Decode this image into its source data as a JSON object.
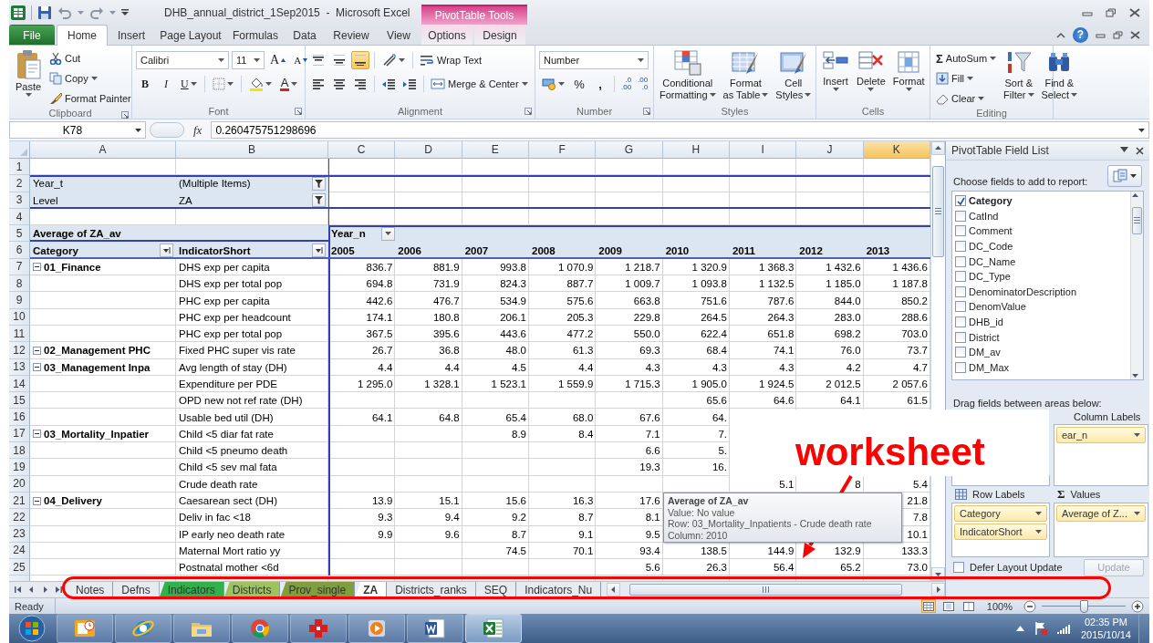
{
  "title_bar": {
    "title": "DHB_annual_district_1Sep2015  -  Microsoft Excel",
    "context_group": "PivotTable Tools"
  },
  "ribbon_tabs": [
    {
      "label": "File",
      "kind": "file",
      "selected": false
    },
    {
      "label": "Home",
      "kind": "tab",
      "selected": true
    },
    {
      "label": "Insert",
      "kind": "tab",
      "selected": false
    },
    {
      "label": "Page Layout",
      "kind": "tab",
      "selected": false
    },
    {
      "label": "Formulas",
      "kind": "tab",
      "selected": false
    },
    {
      "label": "Data",
      "kind": "tab",
      "selected": false
    },
    {
      "label": "Review",
      "kind": "tab",
      "selected": false
    },
    {
      "label": "View",
      "kind": "tab",
      "selected": false
    },
    {
      "label": "Options",
      "kind": "context",
      "selected": false
    },
    {
      "label": "Design",
      "kind": "context",
      "selected": false
    }
  ],
  "help": "?",
  "clipboard": {
    "label": "Clipboard",
    "paste": "Paste",
    "cut": "Cut",
    "copy": "Copy",
    "format_painter": "Format Painter"
  },
  "font": {
    "label": "Font",
    "name": "Calibri",
    "size": "11",
    "grow": "A",
    "shrink": "A",
    "bold": "B",
    "italic": "I",
    "underline": "U",
    "font_color": "A"
  },
  "alignment": {
    "label": "Alignment",
    "vertical": [
      {
        "selected": false
      },
      {
        "selected": false
      },
      {
        "selected": true
      }
    ],
    "wrap_text": "Wrap Text",
    "merge_center": "Merge & Center"
  },
  "number": {
    "label": "Number",
    "format": "Number",
    "percent": "%",
    "comma": ",",
    "increase_decimal": [
      ".0",
      ".00"
    ],
    "decrease_decimal": [
      ".00",
      ".0"
    ]
  },
  "styles": {
    "label": "Styles",
    "buttons": [
      [
        "Conditional",
        "Formatting"
      ],
      [
        "Format",
        "as Table"
      ],
      [
        "Cell",
        "Styles"
      ]
    ]
  },
  "cells": {
    "label": "Cells",
    "buttons": [
      "Insert",
      "Delete",
      "Format"
    ]
  },
  "editing": {
    "label": "Editing",
    "sigma": "Σ",
    "autosum": "AutoSum",
    "fill": "Fill",
    "clear": "Clear",
    "sort_filter": [
      "Sort &",
      "Filter"
    ],
    "find_select": [
      "Find &",
      "Select"
    ]
  },
  "formula_bar": {
    "name_box": "K78",
    "fx": "fx",
    "value": "0.260475751298696"
  },
  "sheet": {
    "columns": [
      {
        "letter": "A",
        "selected": false
      },
      {
        "letter": "B",
        "selected": false
      },
      {
        "letter": "C",
        "selected": false
      },
      {
        "letter": "D",
        "selected": false
      },
      {
        "letter": "E",
        "selected": false
      },
      {
        "letter": "F",
        "selected": false
      },
      {
        "letter": "G",
        "selected": false
      },
      {
        "letter": "H",
        "selected": false
      },
      {
        "letter": "I",
        "selected": false
      },
      {
        "letter": "J",
        "selected": false
      },
      {
        "letter": "K",
        "selected": true
      }
    ],
    "rows": [
      {
        "number": "1",
        "kind": "blank"
      },
      {
        "number": "2",
        "kind": "filter",
        "cells": {
          "A": "Year_t",
          "B": "(Multiple Items)"
        }
      },
      {
        "number": "3",
        "kind": "filter",
        "cells": {
          "A": "Level",
          "B": "ZA"
        }
      },
      {
        "number": "4",
        "kind": "blank"
      },
      {
        "number": "5",
        "kind": "value_header",
        "cells": {
          "A": "Average of ZA_av",
          "C": "Year_n"
        }
      },
      {
        "number": "6",
        "kind": "field_header",
        "cells": {
          "A": "Category",
          "B": "IndicatorShort",
          "C": "2005",
          "D": "2006",
          "E": "2007",
          "F": "2008",
          "G": "2009",
          "H": "2010",
          "I": "2011",
          "J": "2012",
          "K": "2013"
        }
      },
      {
        "number": "7",
        "kind": "data",
        "category": {
          "text": "01_Finance",
          "expanded": true
        },
        "cells": {
          "B": "DHS exp per capita",
          "C": "836.7",
          "D": "881.9",
          "E": "993.8",
          "F": "1 070.9",
          "G": "1 218.7",
          "H": "1 320.9",
          "I": "1 368.3",
          "J": "1 432.6",
          "K": "1 436.6"
        }
      },
      {
        "number": "8",
        "kind": "data",
        "cells": {
          "B": "DHS exp per total pop",
          "C": "694.8",
          "D": "731.9",
          "E": "824.3",
          "F": "887.7",
          "G": "1 009.7",
          "H": "1 093.8",
          "I": "1 132.5",
          "J": "1 185.0",
          "K": "1 187.8"
        }
      },
      {
        "number": "9",
        "kind": "data",
        "cells": {
          "B": "PHC exp per capita",
          "C": "442.6",
          "D": "476.7",
          "E": "534.9",
          "F": "575.6",
          "G": "663.8",
          "H": "751.6",
          "I": "787.6",
          "J": "844.0",
          "K": "850.2"
        }
      },
      {
        "number": "10",
        "kind": "data",
        "cells": {
          "B": "PHC exp per headcount",
          "C": "174.1",
          "D": "180.8",
          "E": "206.1",
          "F": "205.3",
          "G": "229.8",
          "H": "264.5",
          "I": "264.3",
          "J": "283.0",
          "K": "288.6"
        }
      },
      {
        "number": "11",
        "kind": "data",
        "cells": {
          "B": "PHC exp per total pop",
          "C": "367.5",
          "D": "395.6",
          "E": "443.6",
          "F": "477.2",
          "G": "550.0",
          "H": "622.4",
          "I": "651.8",
          "J": "698.2",
          "K": "703.0"
        }
      },
      {
        "number": "12",
        "kind": "data",
        "category": {
          "text": "02_Management PHC",
          "expanded": true
        },
        "cells": {
          "B": "Fixed PHC super vis rate",
          "C": "26.7",
          "D": "36.8",
          "E": "48.0",
          "F": "61.3",
          "G": "69.3",
          "H": "68.4",
          "I": "74.1",
          "J": "76.0",
          "K": "73.7"
        }
      },
      {
        "number": "13",
        "kind": "data",
        "category": {
          "text": "03_Management Inpa",
          "expanded": true
        },
        "cells": {
          "B": "Avg length of stay (DH)",
          "C": "4.4",
          "D": "4.4",
          "E": "4.5",
          "F": "4.4",
          "G": "4.3",
          "H": "4.3",
          "I": "4.3",
          "J": "4.2",
          "K": "4.7"
        }
      },
      {
        "number": "14",
        "kind": "data",
        "cells": {
          "B": "Expenditure per PDE",
          "C": "1 295.0",
          "D": "1 328.1",
          "E": "1 523.1",
          "F": "1 559.9",
          "G": "1 715.3",
          "H": "1 905.0",
          "I": "1 924.5",
          "J": "2 012.5",
          "K": "2 057.6"
        }
      },
      {
        "number": "15",
        "kind": "data",
        "cells": {
          "B": "OPD new not ref rate (DH)",
          "H": "65.6",
          "I": "64.6",
          "J": "64.1",
          "K": "61.5"
        }
      },
      {
        "number": "16",
        "kind": "data",
        "cells": {
          "B": "Usable bed util (DH)",
          "C": "64.1",
          "D": "64.8",
          "E": "65.4",
          "F": "68.0",
          "G": "67.6",
          "H": "64."
        }
      },
      {
        "number": "17",
        "kind": "data",
        "category": {
          "text": "03_Mortality_Inpatier",
          "expanded": true
        },
        "cells": {
          "B": "Child <5 diar fat rate",
          "E": "8.9",
          "F": "8.4",
          "G": "7.1",
          "H": "7."
        }
      },
      {
        "number": "18",
        "kind": "data",
        "cells": {
          "B": "Child <5 pneumo death",
          "G": "6.6",
          "H": "5."
        }
      },
      {
        "number": "19",
        "kind": "data",
        "cells": {
          "B": "Child <5 sev mal fata",
          "G": "19.3",
          "H": "16."
        }
      },
      {
        "number": "20",
        "kind": "data",
        "cells": {
          "B": "Crude death rate",
          "I": "5.1",
          "J": "8",
          "K": "5.4"
        }
      },
      {
        "number": "21",
        "kind": "data",
        "category": {
          "text": "04_Delivery",
          "expanded": true
        },
        "cells": {
          "B": "Caesarean sect (DH)",
          "C": "13.9",
          "D": "15.1",
          "E": "15.6",
          "F": "16.3",
          "G": "17.6",
          "K": "21.8"
        }
      },
      {
        "number": "22",
        "kind": "data",
        "cells": {
          "B": "Deliv in fac <18",
          "C": "9.3",
          "D": "9.4",
          "E": "9.2",
          "F": "8.7",
          "G": "8.1",
          "K": "7.8"
        }
      },
      {
        "number": "23",
        "kind": "data",
        "cells": {
          "B": "IP early neo death rate",
          "C": "9.9",
          "D": "9.6",
          "E": "8.7",
          "F": "9.1",
          "G": "9.5",
          "K": "10.1"
        }
      },
      {
        "number": "24",
        "kind": "data",
        "cells": {
          "B": "Maternal Mort ratio yy",
          "E": "74.5",
          "F": "70.1",
          "G": "93.4",
          "H": "138.5",
          "I": "144.9",
          "J": "132.9",
          "K": "133.3"
        }
      },
      {
        "number": "25",
        "kind": "data",
        "cells": {
          "B": "Postnatal mother <6d",
          "G": "5.6",
          "H": "26.3",
          "I": "56.4",
          "J": "65.2",
          "K": "73.0"
        }
      }
    ]
  },
  "tooltip": {
    "title": "Average of ZA_av",
    "lines": [
      "Value: No value",
      "Row: 03_Mortality_Inpatients - Crude death rate",
      "Column: 2010"
    ]
  },
  "annotation": {
    "label": "worksheet"
  },
  "sheet_tabs": [
    {
      "label": "Notes",
      "selected": false
    },
    {
      "label": "Defns",
      "selected": false
    },
    {
      "label": "Indicators",
      "selected": false,
      "color": "#2db34a"
    },
    {
      "label": "Districts",
      "selected": false,
      "color": "#9cc45c"
    },
    {
      "label": "Prov_single",
      "selected": false,
      "color": "#7f9f3f"
    },
    {
      "label": "ZA",
      "selected": true
    },
    {
      "label": "Districts_ranks",
      "selected": false
    },
    {
      "label": "SEQ",
      "selected": false
    },
    {
      "label": "Indicators_Nu",
      "selected": false
    }
  ],
  "pivot_panel": {
    "title": "PivotTable Field List",
    "choose_label": "Choose fields to add to report:",
    "fields": [
      {
        "label": "Category",
        "checked": true
      },
      {
        "label": "CatInd",
        "checked": false
      },
      {
        "label": "Comment",
        "checked": false
      },
      {
        "label": "DC_Code",
        "checked": false
      },
      {
        "label": "DC_Name",
        "checked": false
      },
      {
        "label": "DC_Type",
        "checked": false
      },
      {
        "label": "DenominatorDescription",
        "checked": false
      },
      {
        "label": "DenomValue",
        "checked": false
      },
      {
        "label": "DHB_id",
        "checked": false
      },
      {
        "label": "District",
        "checked": false
      },
      {
        "label": "DM_av",
        "checked": false
      },
      {
        "label": "DM_Max",
        "checked": false
      }
    ],
    "drag_label": "Drag fields between areas below:",
    "column_labels": {
      "label": "Column Labels",
      "items": [
        "ear_n"
      ]
    },
    "row_labels": {
      "label": "Row Labels",
      "items": [
        "Category",
        "IndicatorShort"
      ]
    },
    "values": {
      "symbol": "Σ",
      "label": "Values",
      "items": [
        "Average of Z..."
      ]
    },
    "defer": {
      "label": "Defer Layout Update",
      "checked": false
    },
    "update": {
      "label": "Update",
      "disabled": true
    }
  },
  "status_bar": {
    "status": "Ready",
    "views": [
      {
        "selected": true
      },
      {
        "selected": false
      },
      {
        "selected": false
      }
    ],
    "zoom": "100%",
    "zoom_slider": {
      "level": 0.5
    }
  },
  "taskbar": {
    "apps": [
      {
        "kind": "outlook",
        "selected": false
      },
      {
        "kind": "ie",
        "selected": false
      },
      {
        "kind": "explorer",
        "selected": false
      },
      {
        "kind": "chrome",
        "selected": false
      },
      {
        "kind": "red_app",
        "selected": false
      },
      {
        "kind": "media",
        "selected": false
      },
      {
        "kind": "word",
        "selected": false
      },
      {
        "kind": "excel",
        "selected": true
      }
    ],
    "time": "02:35 PM",
    "date": "2015/10/14"
  }
}
